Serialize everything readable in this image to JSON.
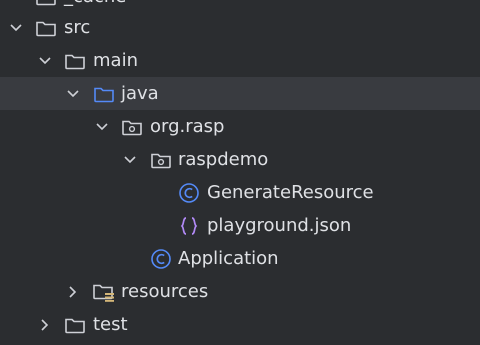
{
  "tree": {
    "partial_top_label": "_cache",
    "items": [
      {
        "name": "src",
        "expanded": true,
        "icon": "folder-icon"
      },
      {
        "name": "main",
        "expanded": true,
        "icon": "folder-icon"
      },
      {
        "name": "java",
        "expanded": true,
        "icon": "source-folder-icon",
        "selected": true
      },
      {
        "name": "org.rasp",
        "expanded": true,
        "icon": "package-icon"
      },
      {
        "name": "raspdemo",
        "expanded": true,
        "icon": "package-icon"
      },
      {
        "name": "GenerateResource",
        "icon": "class-icon"
      },
      {
        "name": "playground.json",
        "icon": "json-file-icon"
      },
      {
        "name": "Application",
        "icon": "class-icon"
      },
      {
        "name": "resources",
        "expanded": false,
        "icon": "resources-folder-icon"
      },
      {
        "name": "test",
        "expanded": false,
        "icon": "folder-icon"
      }
    ]
  },
  "colors": {
    "background": "#2b2d30",
    "selection": "#393b40",
    "text": "#dfe1e5",
    "chevron": "#ced0d6",
    "folder": "#ced0d6",
    "source_folder_blue": "#548af7",
    "class_blue": "#548af7",
    "json_purple": "#b189f5",
    "resources_yellow": "#d5b778"
  }
}
